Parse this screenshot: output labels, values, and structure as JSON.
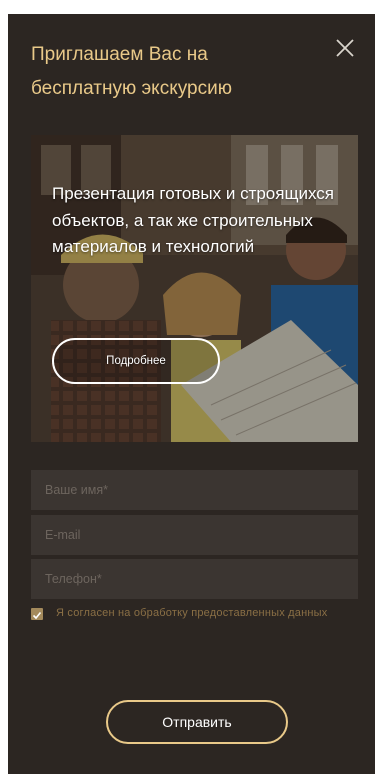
{
  "modal": {
    "title": "Приглашаем Вас на бесплатную экскурсию",
    "close_icon": "close-icon"
  },
  "promo": {
    "text": "Презентация готовых и строящихся объектов, а так же строительных материалов и технологий",
    "button_label": "Подробнее",
    "image": "construction-workers-reviewing-blueprint-photo"
  },
  "form": {
    "name_placeholder": "Ваше имя*",
    "email_placeholder": "E-mail",
    "phone_placeholder": "Телефон*",
    "consent_checked": true,
    "consent_text": "Я согласен на обработку предоставленных данных",
    "submit_label": "Отправить"
  },
  "colors": {
    "panel_bg": "#2c2622",
    "accent_gold": "#e9c989",
    "field_bg": "#3b3531",
    "consent_text": "#8a6f45"
  }
}
